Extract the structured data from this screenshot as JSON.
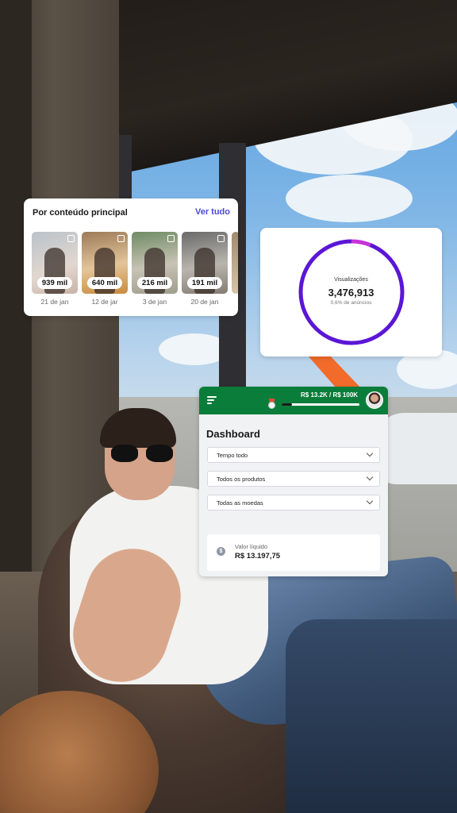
{
  "content_card": {
    "title": "Por conteúdo principal",
    "see_all": "Ver tudo",
    "items": [
      {
        "views": "939 mil",
        "date": "21 de jan"
      },
      {
        "views": "640 mil",
        "date": "12 de jar"
      },
      {
        "views": "216 mil",
        "date": "3 de jan"
      },
      {
        "views": "191 mil",
        "date": "20 de jan"
      }
    ]
  },
  "views_card": {
    "label": "Visualizações",
    "value": "3,476,913",
    "sub": "0,6% de anúncios",
    "ads_share": 0.006,
    "colors": {
      "organic": "#5b16d6",
      "ads": "#c633d9"
    }
  },
  "dashboard": {
    "goal_text": "R$ 13.2K / R$ 100K",
    "goal_progress": 0.132,
    "title": "Dashboard",
    "filters": [
      "Tempo todo",
      "Todos os produtos",
      "Todas as moedas"
    ],
    "metric": {
      "label": "Valor líquido",
      "value": "R$ 13.197,75"
    },
    "colors": {
      "header": "#0b7d3a"
    },
    "icons": {
      "menu": "menu-icon",
      "goal": "medal-icon",
      "coin": "dollar-coin-icon",
      "filter": "chevron-down-icon"
    }
  }
}
